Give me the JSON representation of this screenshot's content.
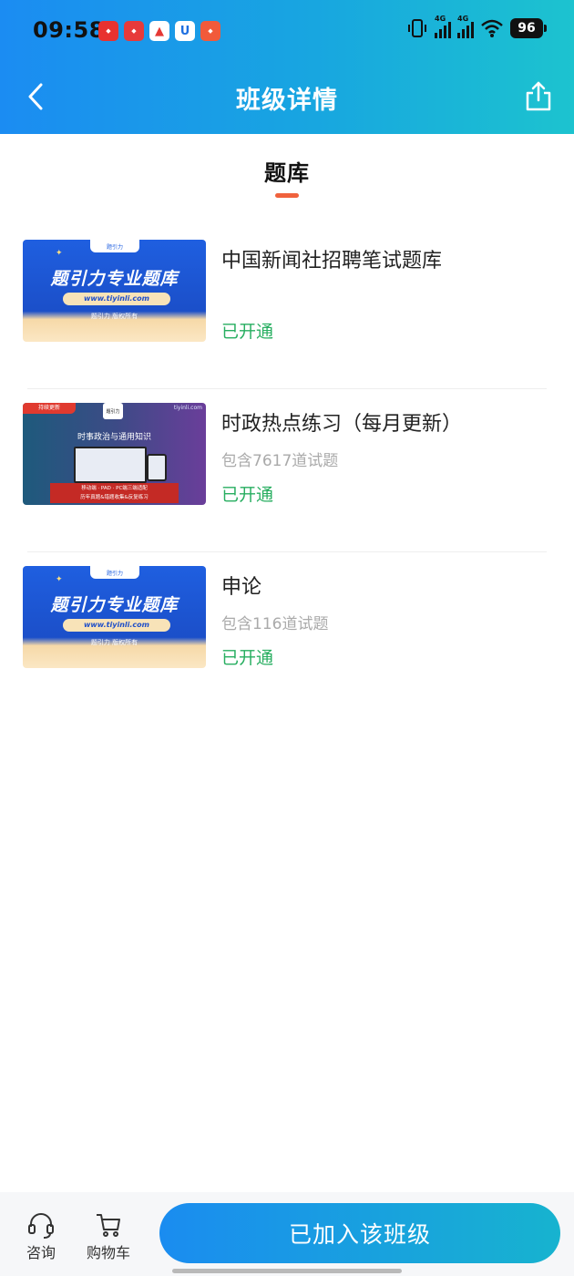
{
  "status_bar": {
    "time": "09:58",
    "network_1": "4G",
    "network_2": "4G",
    "battery": "96",
    "app_icons": [
      "offcn-icon",
      "zhonggong-icon",
      "app-a-icon",
      "app-u-icon",
      "app-news-icon"
    ]
  },
  "nav": {
    "title": "班级详情",
    "back_icon": "chevron-left-icon",
    "share_icon": "share-icon"
  },
  "section": {
    "tab_label": "题库",
    "accent_color": "#f0623d"
  },
  "thumbnails": {
    "brand_title": "题引力专业题库",
    "brand_url": "www.tiyinli.com",
    "brand_copyright": "题引力 版权所有",
    "brand_logo": "题引力",
    "politics_badge": "持续更新",
    "politics_logo": "题引力",
    "politics_site": "tiyinli.com",
    "politics_title": "时事政治与通用知识",
    "politics_banner_line1": "移动端 · PAD · PC端三端适配",
    "politics_banner_line2": "历年真题&错题收集&反复练习"
  },
  "banks": [
    {
      "title": "中国新闻社招聘笔试题库",
      "subtitle": "",
      "status": "已开通",
      "thumb": "brand"
    },
    {
      "title": "时政热点练习（每月更新）",
      "subtitle": "包含7617道试题",
      "status": "已开通",
      "thumb": "politics"
    },
    {
      "title": "申论",
      "subtitle": "包含116道试题",
      "status": "已开通",
      "thumb": "brand"
    }
  ],
  "bottom_bar": {
    "consult_label": "咨询",
    "consult_icon": "headset-icon",
    "cart_label": "购物车",
    "cart_icon": "shopping-cart-icon",
    "join_button_label": "已加入该班级"
  },
  "colors": {
    "header_gradient_start": "#1b8cf2",
    "header_gradient_end": "#1cc3cf",
    "status_open": "#27ae60"
  }
}
